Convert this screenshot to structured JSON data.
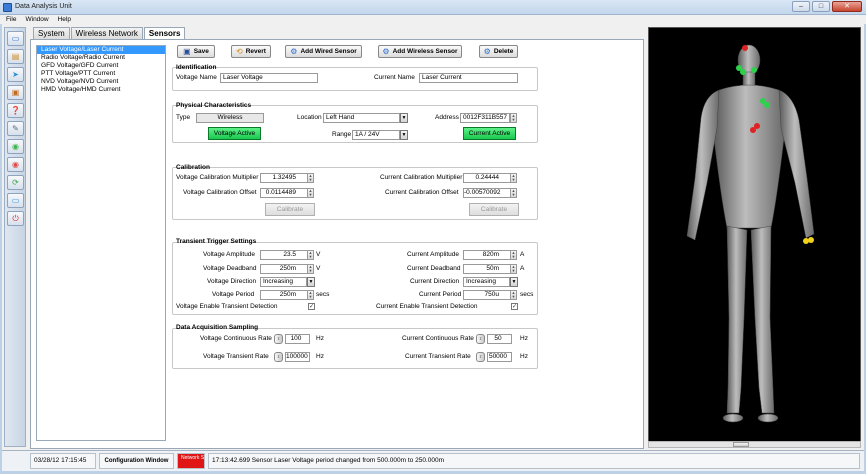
{
  "window": {
    "title": "Data Analysis Unit",
    "buttons": [
      "–",
      "□",
      "✕"
    ]
  },
  "menu": [
    "File",
    "Window",
    "Help"
  ],
  "toolbar_icons": [
    "window-icon",
    "chart-icon",
    "export-icon",
    "gallery-icon",
    "help-icon",
    "wrench-icon",
    "power-on-icon",
    "power-off-icon",
    "refresh-icon",
    "monitor-icon",
    "stop-icon"
  ],
  "tabs": [
    {
      "label": "System",
      "active": false
    },
    {
      "label": "Wireless Network",
      "active": false
    },
    {
      "label": "Sensors",
      "active": true
    }
  ],
  "sensor_list": [
    "Laser Voltage/Laser Current",
    "Radio Voltage/Radio Current",
    "GFD Voltage/GFD Current",
    "PTT Voltage/PTT Current",
    "NVD Voltage/NVD Current",
    "HMD Voltage/HMD Current"
  ],
  "actions": {
    "save": "Save",
    "revert": "Revert",
    "add_wired": "Add Wired Sensor",
    "add_wireless": "Add Wireless Sensor",
    "delete": "Delete"
  },
  "identification": {
    "title": "Identification",
    "voltage_name_label": "Voltage Name",
    "voltage_name": "Laser Voltage",
    "current_name_label": "Current Name",
    "current_name": "Laser Current"
  },
  "physical": {
    "title": "Physical Characteristics",
    "type_label": "Type",
    "type": "Wireless",
    "location_label": "Location",
    "location": "Left Hand",
    "address_label": "Address",
    "address": "0012F311B557",
    "range_label": "Range",
    "range": "1A / 24V",
    "voltage_active": "Voltage Active",
    "current_active": "Current Active"
  },
  "calibration": {
    "title": "Calibration",
    "v_mult_label": "Voltage Calibration Multiplier",
    "v_mult": "1.32495",
    "v_off_label": "Voltage Calibration Offset",
    "v_off": "0.0114489",
    "c_mult_label": "Current Calibration Multiplier",
    "c_mult": "0.24444",
    "c_off_label": "Current Calibration Offset",
    "c_off": "-0.00570092",
    "calibrate": "Calibrate"
  },
  "transient": {
    "title": "Transient Trigger Settings",
    "v_amp_label": "Voltage Amplitude",
    "v_amp": "23.5",
    "v_unit": "V",
    "v_dead_label": "Voltage Deadband",
    "v_dead": "250m",
    "v_dir_label": "Voltage Direction",
    "v_dir": "Increasing",
    "v_period_label": "Voltage Period",
    "v_period": "250m",
    "secs": "secs",
    "v_enable_label": "Voltage Enable Transient Detection",
    "c_amp_label": "Current Amplitude",
    "c_amp": "820m",
    "c_unit": "A",
    "c_dead_label": "Current Deadband",
    "c_dead": "50m",
    "c_dir_label": "Current Direction",
    "c_dir": "Increasing",
    "c_period_label": "Current Period",
    "c_period": "750u",
    "c_enable_label": "Current Enable Transient Detection"
  },
  "acquisition": {
    "title": "Data Acquisition Sampling",
    "v_cont_label": "Voltage Continuous Rate",
    "v_cont": "100",
    "hz": "Hz",
    "v_trans_label": "Voltage Transient Rate",
    "v_trans": "100000",
    "c_cont_label": "Current Continuous Rate",
    "c_cont": "50",
    "c_trans_label": "Current Transient Rate",
    "c_trans": "50000"
  },
  "status": {
    "timestamp": "03/28/12 17:15:45",
    "window_name": "Configuration Window",
    "network": "Network Status",
    "message": "17:13:42.699 Sensor Laser Voltage period changed from 500.000m to 250.000m"
  },
  "colors": {
    "active_green": "#22dd55",
    "network_red": "#e01515",
    "selection_blue": "#3399ff",
    "sensor_green": "#2bd34a",
    "sensor_red": "#e02222",
    "sensor_yellow": "#f2d21a"
  }
}
